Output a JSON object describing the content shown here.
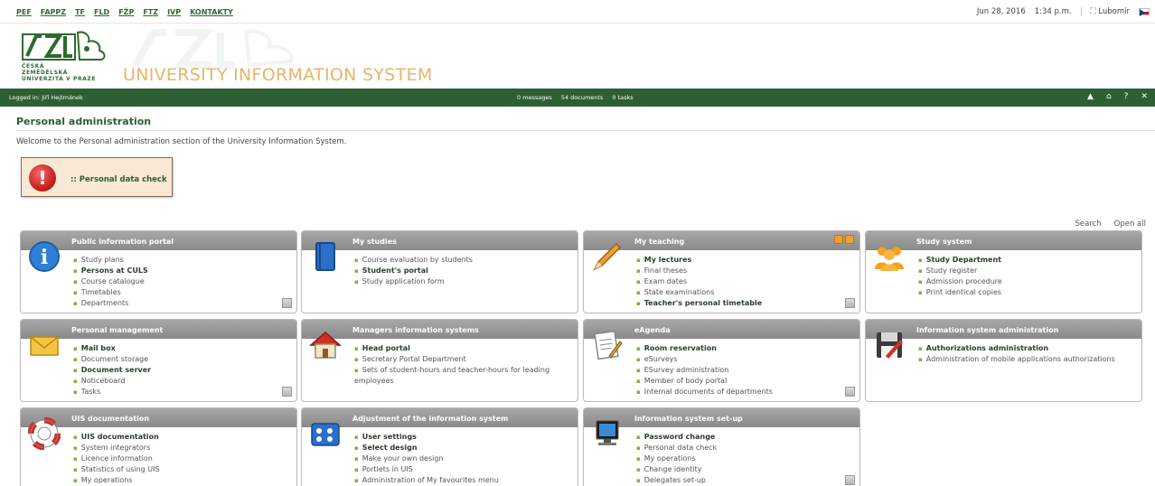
{
  "topbar": {
    "faculty_links": [
      "PEF",
      "FAPPZ",
      "TF",
      "FLD",
      "FŽP",
      "FTZ",
      "IVP",
      "KONTAKTY"
    ],
    "date": "Jun 28, 2016",
    "time": "1:34 p.m.",
    "user": "Lubomír"
  },
  "header": {
    "logo_text": "ČESKÁ\nZEMĚDĚLSKÁ\nUNIVERZITA V PRAZE",
    "system_title": "UNIVERSITY INFORMATION SYSTEM"
  },
  "statusbar": {
    "logged_in": "Logged in: Jiří Hejtmánek",
    "messages": "0 messages",
    "documents": "54 documents",
    "tasks": "0 tasks"
  },
  "page": {
    "title": "Personal administration",
    "welcome": "Welcome to the Personal administration section of the University Information System.",
    "alert_link": ":: Personal data check",
    "search": "Search",
    "open_all": "Open all"
  },
  "portlets": [
    {
      "title": "Public information portal",
      "items": [
        {
          "label": "Study plans",
          "bold": false
        },
        {
          "label": "Persons at CULS",
          "bold": true
        },
        {
          "label": "Course catalogue",
          "bold": false
        },
        {
          "label": "Timetables",
          "bold": false
        },
        {
          "label": "Departments",
          "bold": false
        }
      ]
    },
    {
      "title": "My studies",
      "items": [
        {
          "label": "Course evaluation by students",
          "bold": false
        },
        {
          "label": "Student's portal",
          "bold": true
        },
        {
          "label": "Study application form",
          "bold": false
        }
      ]
    },
    {
      "title": "My teaching",
      "items": [
        {
          "label": "My lectures",
          "bold": true
        },
        {
          "label": "Final theses",
          "bold": false
        },
        {
          "label": "Exam dates",
          "bold": false
        },
        {
          "label": "State examinations",
          "bold": false
        },
        {
          "label": "Teacher's personal timetable",
          "bold": true
        }
      ]
    },
    {
      "title": "Study system",
      "items": [
        {
          "label": "Study Department",
          "bold": true
        },
        {
          "label": "Study register",
          "bold": false
        },
        {
          "label": "Admission procedure",
          "bold": false
        },
        {
          "label": "Print identical copies",
          "bold": false
        }
      ]
    },
    {
      "title": "Personal management",
      "items": [
        {
          "label": "Mail box",
          "bold": true
        },
        {
          "label": "Document storage",
          "bold": false
        },
        {
          "label": "Document server",
          "bold": true
        },
        {
          "label": "Noticeboard",
          "bold": false
        },
        {
          "label": "Tasks",
          "bold": false
        }
      ]
    },
    {
      "title": "Managers information systems",
      "items": [
        {
          "label": "Head portal",
          "bold": true
        },
        {
          "label": "Secretary Portal Department",
          "bold": false
        },
        {
          "label": "Sets of student-hours and teacher-hours for leading employees",
          "bold": false
        }
      ]
    },
    {
      "title": "eAgenda",
      "items": [
        {
          "label": "Room reservation",
          "bold": true
        },
        {
          "label": "eSurveys",
          "bold": false
        },
        {
          "label": "ESurvey administration",
          "bold": false
        },
        {
          "label": "Member of body portal",
          "bold": false
        },
        {
          "label": "Internal documents of departments",
          "bold": false
        }
      ]
    },
    {
      "title": "Information system administration",
      "items": [
        {
          "label": "Authorizations administration",
          "bold": true
        },
        {
          "label": "Administration of mobile applications authorizations",
          "bold": false
        }
      ]
    },
    {
      "title": "UIS documentation",
      "items": [
        {
          "label": "UIS documentation",
          "bold": true
        },
        {
          "label": "System integrators",
          "bold": false
        },
        {
          "label": "Licence information",
          "bold": false
        },
        {
          "label": "Statistics of using UIS",
          "bold": false
        },
        {
          "label": "My operations",
          "bold": false
        }
      ]
    },
    {
      "title": "Adjustment of the information system",
      "items": [
        {
          "label": "User settings",
          "bold": true
        },
        {
          "label": "Select design",
          "bold": true
        },
        {
          "label": "Make your own design",
          "bold": false
        },
        {
          "label": "Portlets in UIS",
          "bold": false
        },
        {
          "label": "Administration of My favourites menu",
          "bold": false
        }
      ]
    },
    {
      "title": "Information system set-up",
      "items": [
        {
          "label": "Password change",
          "bold": true
        },
        {
          "label": "Personal data check",
          "bold": false
        },
        {
          "label": "My operations",
          "bold": false
        },
        {
          "label": "Change identity",
          "bold": false
        },
        {
          "label": "Delegates set-up",
          "bold": false
        }
      ]
    }
  ],
  "icons": [
    "info-icon",
    "book-icon",
    "pencil-icon",
    "people-icon",
    "envelope-icon",
    "house-icon",
    "notepad-icon",
    "save-icon",
    "lifebuoy-icon",
    "settings-panel-icon",
    "monitor-icon"
  ]
}
